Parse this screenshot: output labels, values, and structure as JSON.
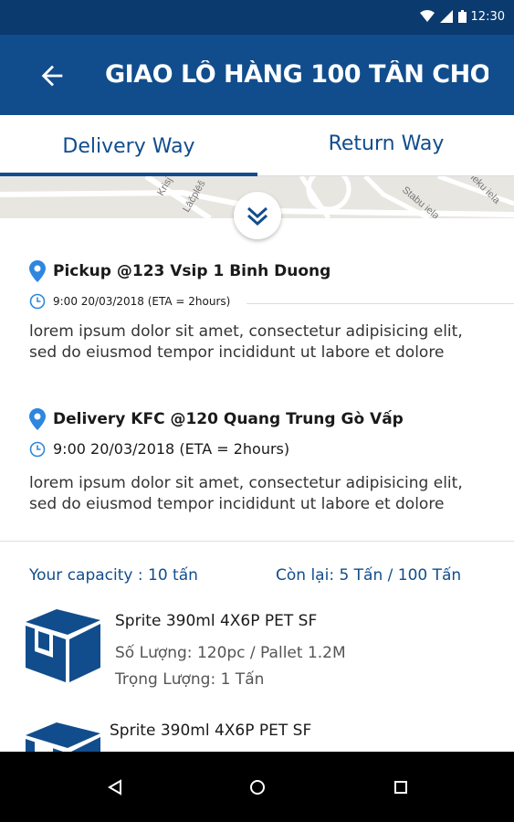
{
  "status_bar": {
    "time": "12:30",
    "icons": [
      "wifi-icon",
      "signal-icon",
      "battery-icon"
    ]
  },
  "app_bar": {
    "title": "GIAO LÔ HÀNG 100 TẤN CHO ....",
    "back_icon": "arrow-back-icon"
  },
  "tabs": [
    {
      "label": "Delivery Way",
      "selected": true
    },
    {
      "label": "Return Way",
      "selected": false
    }
  ],
  "map": {
    "labels": [
      "Krisj",
      "Lāčplēš",
      "Stabu iela",
      "ieku iela"
    ]
  },
  "stops": [
    {
      "title": "Pickup @123 Vsip 1 Binh Duong",
      "time": "9:00 20/03/2018 (ETA = 2hours)",
      "description": "lorem ipsum dolor sit amet, consectetur adipisicing elit, sed do eiusmod tempor incididunt ut labore et dolore"
    },
    {
      "title": "Delivery KFC @120 Quang Trung Gò Vấp",
      "time": "9:00 20/03/2018 (ETA = 2hours)",
      "description": "lorem ipsum dolor sit amet, consectetur adipisicing elit, sed do eiusmod tempor incididunt ut labore et dolore"
    }
  ],
  "capacity": {
    "your_capacity": "Your capacity : 10 tấn",
    "remaining": "Còn lại: 5 Tấn / 100 Tấn"
  },
  "items": [
    {
      "name": "Sprite 390ml 4X6P PET SF",
      "quantity": "Số Lượng: 120pc / Pallet 1.2M",
      "weight": "Trọng Lượng: 1 Tấn"
    },
    {
      "name": "Sprite 390ml 4X6P PET SF"
    }
  ],
  "colors": {
    "primary": "#114d8d",
    "status_bar": "#0b3a6e",
    "pin": "#2e86de"
  }
}
